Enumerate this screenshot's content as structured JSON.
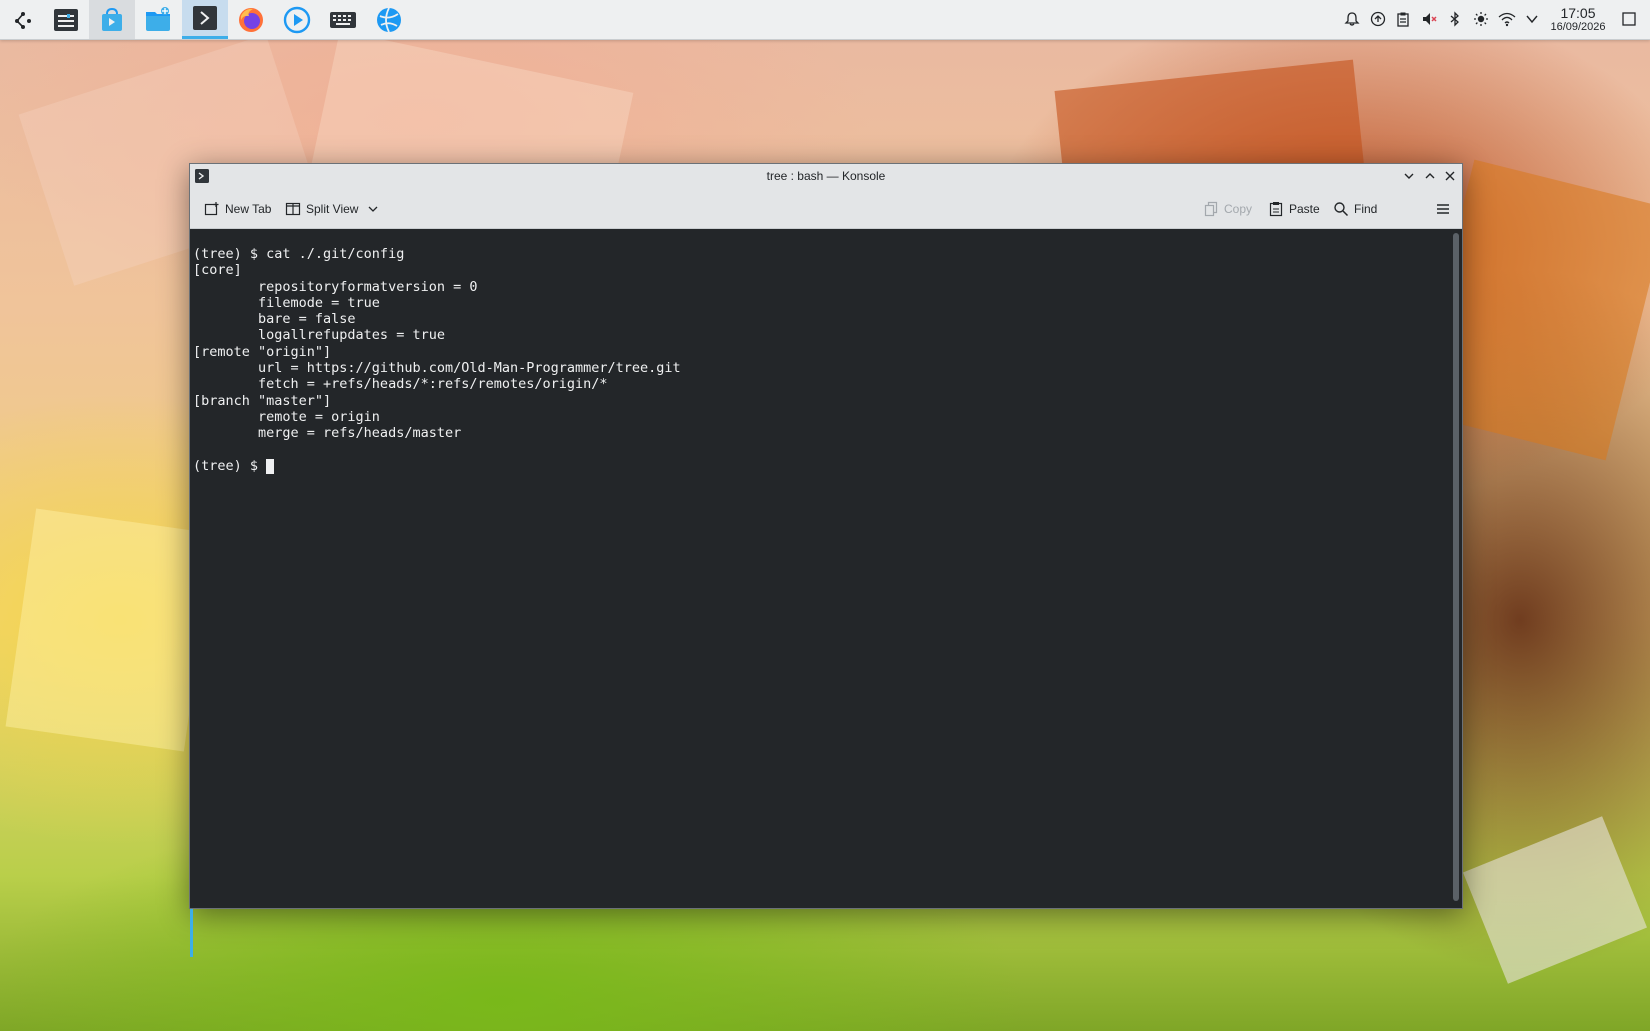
{
  "taskbar": {
    "apps": [
      {
        "name": "application-launcher",
        "icon": "kde-launcher-icon",
        "state": "normal"
      },
      {
        "name": "system-settings",
        "icon": "settings-panel-icon",
        "state": "normal"
      },
      {
        "name": "discover",
        "icon": "discover-bag-icon",
        "state": "open"
      },
      {
        "name": "file-manager",
        "icon": "folder-icon",
        "state": "normal"
      },
      {
        "name": "konsole",
        "icon": "terminal-icon",
        "state": "active"
      },
      {
        "name": "firefox",
        "icon": "firefox-icon",
        "state": "normal"
      },
      {
        "name": "media-player",
        "icon": "play-icon",
        "state": "normal"
      },
      {
        "name": "virtual-keyboard",
        "icon": "keyboard-icon",
        "state": "normal"
      },
      {
        "name": "plasma-vault",
        "icon": "globe-icon",
        "state": "normal"
      }
    ],
    "tray": [
      "notifications-icon",
      "network-monitor-icon",
      "clipboard-icon",
      "volume-muted-icon",
      "bluetooth-icon",
      "brightness-icon",
      "wifi-icon",
      "expand-tray-icon"
    ],
    "clock": {
      "time": "17:05",
      "date": "16/09/2026"
    }
  },
  "window": {
    "title": "tree : bash — Konsole",
    "toolbar": {
      "new_tab": "New Tab",
      "split_view": "Split View",
      "copy": "Copy",
      "paste": "Paste",
      "find": "Find"
    },
    "terminal": {
      "output": "(tree) $ cat ./.git/config\n[core]\n        repositoryformatversion = 0\n        filemode = true\n        bare = false\n        logallrefupdates = true\n[remote \"origin\"]\n        url = https://github.com/Old-Man-Programmer/tree.git\n        fetch = +refs/heads/*:refs/remotes/origin/*\n[branch \"master\"]\n        remote = origin\n        merge = refs/heads/master\n\n",
      "prompt": "(tree) $ "
    }
  },
  "colors": {
    "terminal_bg": "#232629",
    "terminal_fg": "#eff0f1",
    "accent": "#3daee9",
    "chrome": "#e3e5e7"
  }
}
